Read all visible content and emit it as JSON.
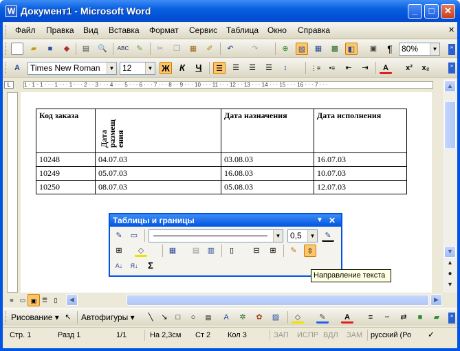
{
  "window": {
    "title": "Документ1 - Microsoft Word",
    "app_icon": "W"
  },
  "menu": {
    "items": [
      "Файл",
      "Правка",
      "Вид",
      "Вставка",
      "Формат",
      "Сервис",
      "Таблица",
      "Окно",
      "Справка"
    ]
  },
  "toolbar_standard": {
    "zoom": "80%",
    "pilcrow": "¶"
  },
  "toolbar_format": {
    "font": "Times New Roman",
    "size": "12",
    "bold": "Ж",
    "italic": "К",
    "underline": "Ч",
    "color_letter": "A",
    "superscript": "x²",
    "subscript": "x₂"
  },
  "ruler": {
    "text": "1 · 1 · 1 · · · 1 · · · 1 · · · 2 · · 3 · · · 4 · · · 5 · · · 6 · · · 7 · · · 8 · · 9 · · · 10 · · · 11 · · · 12 · · 13 · · · 14 · · · 15 · · · 16 · · · 7 · · ·"
  },
  "table": {
    "headers": [
      "Код заказа",
      "Дата\nразмещ\nения",
      "Дата назначения",
      "Дата исполнения"
    ],
    "rows": [
      [
        "10248",
        "04.07.03",
        "03.08.03",
        "16.07.03"
      ],
      [
        "10249",
        "05.07.03",
        "16.08.03",
        "10.07.03"
      ],
      [
        "10250",
        "08.07.03",
        "05.08.03",
        "12.07.03"
      ]
    ]
  },
  "float_toolbar": {
    "title": "Таблицы и границы",
    "line_weight": "0,5",
    "sigma": "Σ"
  },
  "tooltip": "Направление текста",
  "drawbar": {
    "drawing": "Рисование",
    "autoshapes": "Автофигуры"
  },
  "status": {
    "page": "Стр. 1",
    "section": "Разд 1",
    "pages": "1/1",
    "at": "На 2,3см",
    "line": "Ст 2",
    "col": "Кол 3",
    "rec": "ЗАП",
    "trk": "ИСПР",
    "ext": "ВДЛ",
    "ovr": "ЗАМ",
    "lang": "русский (Ро"
  }
}
